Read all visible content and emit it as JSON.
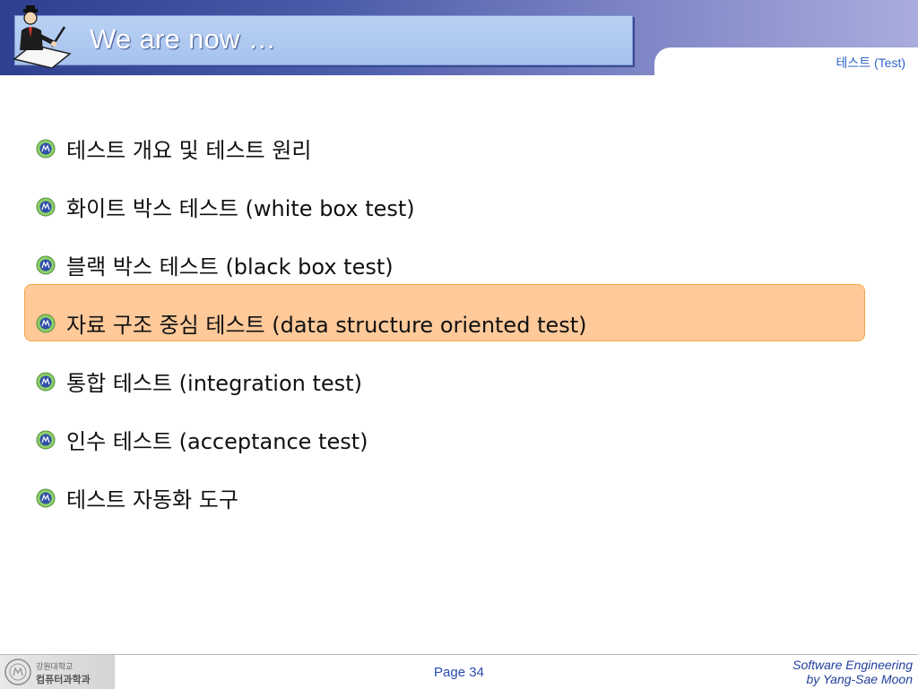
{
  "header": {
    "title": "We are now …",
    "section_label": "테스트 (Test)"
  },
  "bullets": [
    "테스트 개요 및 테스트 원리",
    "화이트 박스 테스트 (white box test)",
    "블랙 박스 테스트 (black box test)",
    "자료 구조 중심 테스트 (data structure oriented test)",
    "통합 테스트 (integration test)",
    "인수 테스트 (acceptance test)",
    "테스트 자동화 도구"
  ],
  "highlighted_item": "자료 구조 중심 테스트 (data structure oriented test)",
  "footer": {
    "org_line1": "강원대학교",
    "org_line2": "컴퓨터과학과",
    "page": "Page 34",
    "course": "Software Engineering",
    "author": "by Yang-Sae Moon"
  },
  "colors": {
    "header_dark": "#2f3f8f",
    "title_box": "#a6c2ee",
    "highlight_fill": "#ffc999",
    "highlight_border": "#f1a64d",
    "footer_text": "#2a49b5"
  },
  "icons": {
    "logo": "businessman-writing-icon",
    "bullet": "university-emblem-icon",
    "footer": "university-seal-icon"
  }
}
